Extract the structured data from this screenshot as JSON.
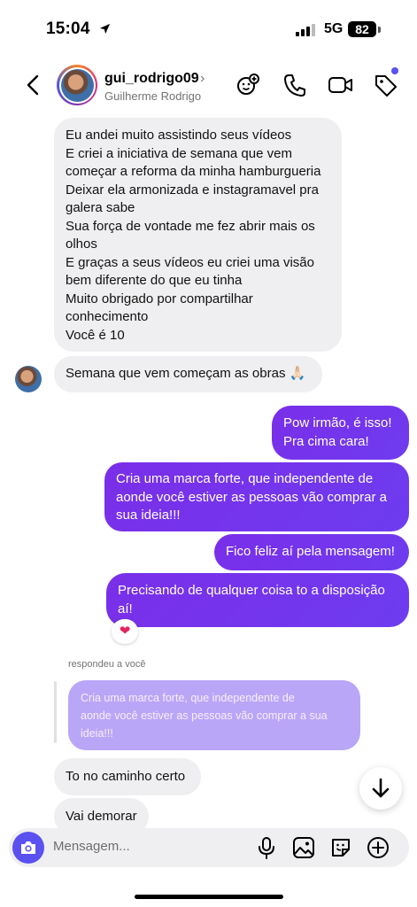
{
  "status": {
    "time": "15:04",
    "network": "5G",
    "battery": "82"
  },
  "header": {
    "username": "gui_rodrigo09",
    "name": "Guilherme Rodrigo"
  },
  "messages": {
    "m1": [
      "Eu andei muito assistindo seus vídeos",
      "E criei a iniciativa de semana que vem",
      "começar a reforma da minha hamburgueria",
      "Deixar ela armonizada e instagramavel pra",
      "galera sabe",
      "Sua força de vontade me fez abrir mais os",
      "olhos",
      "E graças a seus vídeos eu criei uma visão",
      "bem diferente do que eu tinha",
      "Muito obrigado por compartilhar",
      "conhecimento",
      "Você é 10"
    ],
    "m2": "Semana que vem começam as obras 🙏🏻",
    "m3": [
      "Pow irmão, é isso!",
      "Pra cima cara!"
    ],
    "m4": [
      "Cria uma marca forte, que independente de",
      "aonde você estiver as pessoas vão comprar a",
      "sua ideia!!!"
    ],
    "m5": "Fico feliz aí pela mensagem!",
    "m6": [
      "Precisando de qualquer coisa to a disposição",
      "aí!"
    ],
    "reaction": "❤",
    "reply_label": "respondeu a você",
    "quote": [
      "Cria uma marca forte, que independente de",
      "aonde você estiver as pessoas vão comprar a sua",
      "ideia!!!"
    ],
    "m7": "To no caminho certo",
    "m8": "Vai demorar"
  },
  "composer": {
    "placeholder": "Mensagem..."
  },
  "icons": {
    "location": "location-arrow-icon",
    "back": "chevron-left-icon",
    "header": [
      "sticker-add-icon",
      "phone-icon",
      "video-icon",
      "tag-icon"
    ],
    "composer": [
      "camera-icon",
      "microphone-icon",
      "image-icon",
      "sticker-icon",
      "plus-circle-icon"
    ],
    "scroll": "arrow-down-icon"
  },
  "colors": {
    "outgoing": "#7a2ee8",
    "incoming": "#efeff1",
    "accent": "#5b51f0",
    "quote": "#b9a6f7"
  }
}
